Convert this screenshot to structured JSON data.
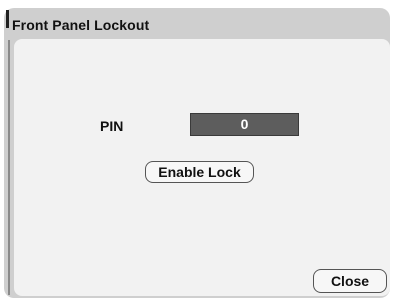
{
  "dialog": {
    "title": "Front Panel Lockout"
  },
  "pin": {
    "label": "PIN",
    "value": "0"
  },
  "buttons": {
    "enable_lock_label": "Enable Lock",
    "close_label": "Close"
  },
  "colors": {
    "window_frame": "#cfcfcf",
    "panel_background": "#f2f2f2",
    "pin_field_background": "#5d5d5d",
    "pin_field_text": "#ffffff"
  }
}
